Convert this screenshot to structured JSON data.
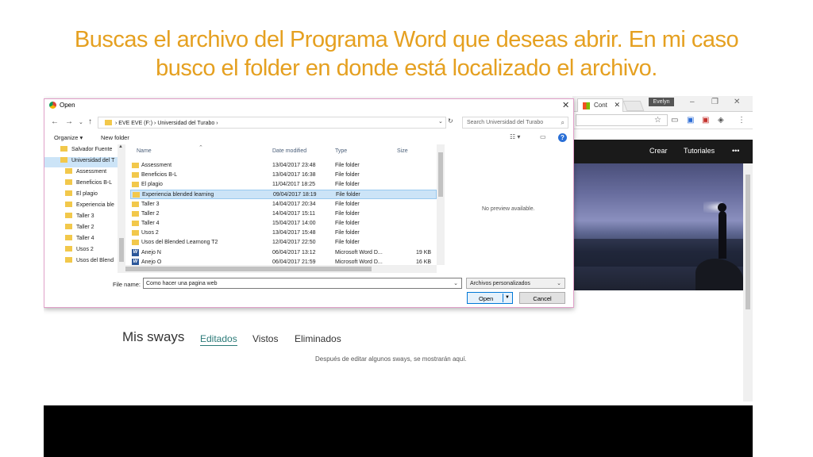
{
  "slide": {
    "title_line1": "Buscas el archivo del Programa Word que deseas abrir.  En mi caso",
    "title_line2": "busco el folder en donde está localizado el archivo."
  },
  "colors": {
    "title": "#e5a020",
    "selection": "#cce4f7",
    "folder": "#f2c84b",
    "word": "#2b579a"
  },
  "chrome": {
    "tab_label": "Cont",
    "user_badge": "Evelyn",
    "menu": [
      "Crear",
      "Tutoriales",
      "•••"
    ]
  },
  "dialog": {
    "title": "Open",
    "breadcrumb": [
      "EVE EVE (F:)",
      "Universidad del Turabo"
    ],
    "search_placeholder": "Search Universidad del Turabo",
    "toolbar": {
      "organize": "Organize ▾",
      "new_folder": "New folder"
    },
    "nav_items": [
      "Salvador Fuente",
      "Universidad del T",
      "Assessment",
      "Beneficios B-L",
      "El plagio",
      "Experiencia ble",
      "Taller 3",
      "Taller 2",
      "Taller 4",
      "Usos 2",
      "Usos del Blend"
    ],
    "columns": {
      "name": "Name",
      "date": "Date modified",
      "type": "Type",
      "size": "Size"
    },
    "files": [
      {
        "name": "Assessment",
        "date": "13/04/2017 23:48",
        "type": "File folder",
        "size": "",
        "icon": "folder-icon"
      },
      {
        "name": "Beneficios B-L",
        "date": "13/04/2017 16:38",
        "type": "File folder",
        "size": "",
        "icon": "folder-icon"
      },
      {
        "name": "El plagio",
        "date": "11/04/2017 18:25",
        "type": "File folder",
        "size": "",
        "icon": "folder-icon"
      },
      {
        "name": "Experiencia blended learning",
        "date": "09/04/2017 18:19",
        "type": "File folder",
        "size": "",
        "icon": "folder-icon"
      },
      {
        "name": "Taller 3",
        "date": "14/04/2017 20:34",
        "type": "File folder",
        "size": "",
        "icon": "folder-icon"
      },
      {
        "name": "Taller 2",
        "date": "14/04/2017 15:11",
        "type": "File folder",
        "size": "",
        "icon": "folder-icon"
      },
      {
        "name": "Taller 4",
        "date": "15/04/2017 14:00",
        "type": "File folder",
        "size": "",
        "icon": "folder-icon"
      },
      {
        "name": "Usos 2",
        "date": "13/04/2017 15:48",
        "type": "File folder",
        "size": "",
        "icon": "folder-icon"
      },
      {
        "name": "Usos del Blended Learnong T2",
        "date": "12/04/2017 22:50",
        "type": "File folder",
        "size": "",
        "icon": "folder-icon"
      },
      {
        "name": "Anejo N",
        "date": "06/04/2017 13:12",
        "type": "Microsoft Word D...",
        "size": "19 KB",
        "icon": "word-doc-icon"
      },
      {
        "name": "Anejo O",
        "date": "06/04/2017 21:59",
        "type": "Microsoft Word D...",
        "size": "16 KB",
        "icon": "word-doc-icon"
      }
    ],
    "selected_file": "Experiencia blended learning",
    "preview_text": "No preview available.",
    "file_name_label": "File name:",
    "file_name_value": "Como hacer una pagina web",
    "file_type": "Archivos personalizados",
    "open_label": "Open",
    "cancel_label": "Cancel"
  },
  "sways": {
    "title": "Mis sways",
    "tabs": [
      "Editados",
      "Vistos",
      "Eliminados"
    ],
    "active_tab": "Editados",
    "empty_message": "Después de editar algunos sways, se mostrarán aquí."
  }
}
